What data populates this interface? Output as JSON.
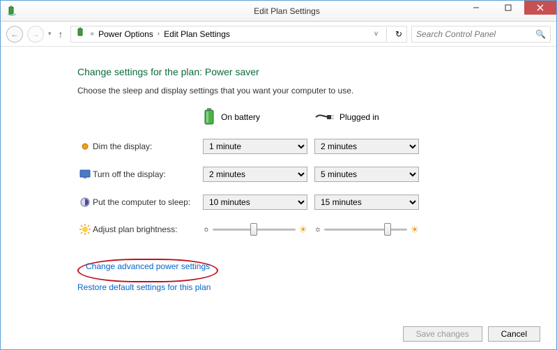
{
  "window": {
    "title": "Edit Plan Settings"
  },
  "breadcrumb": {
    "item1": "Power Options",
    "item2": "Edit Plan Settings"
  },
  "search": {
    "placeholder": "Search Control Panel"
  },
  "page": {
    "heading": "Change settings for the plan: Power saver",
    "subtext": "Choose the sleep and display settings that you want your computer to use.",
    "col_battery": "On battery",
    "col_plugged": "Plugged in"
  },
  "rows": {
    "dim": {
      "label": "Dim the display:",
      "battery": "1 minute",
      "plugged": "2 minutes"
    },
    "off": {
      "label": "Turn off the display:",
      "battery": "2 minutes",
      "plugged": "5 minutes"
    },
    "sleep": {
      "label": "Put the computer to sleep:",
      "battery": "10 minutes",
      "plugged": "15 minutes"
    },
    "brightness": {
      "label": "Adjust plan brightness:",
      "battery_pct": 50,
      "plugged_pct": 80
    }
  },
  "links": {
    "advanced": "Change advanced power settings",
    "restore": "Restore default settings for this plan"
  },
  "buttons": {
    "save": "Save changes",
    "cancel": "Cancel"
  }
}
